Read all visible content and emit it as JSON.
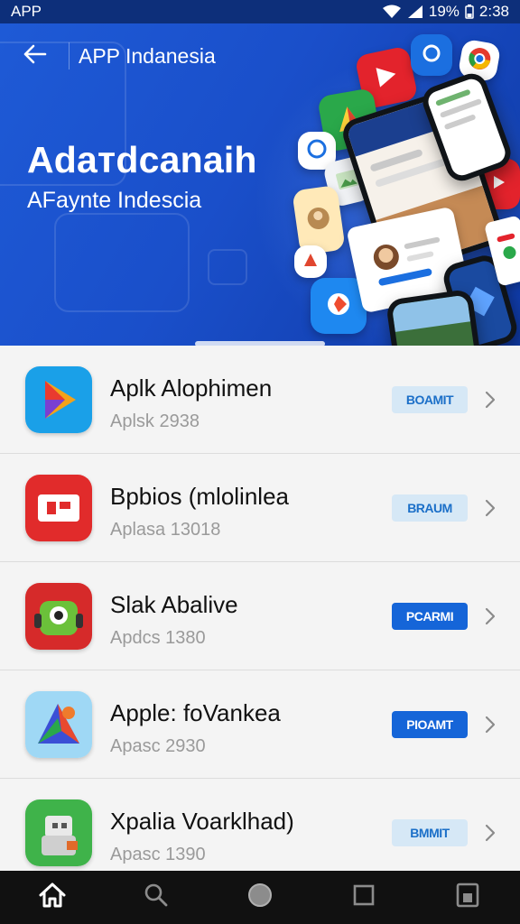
{
  "status_bar": {
    "app_label": "APP",
    "battery": "19%",
    "time": "2:38"
  },
  "header": {
    "title": "APP Indanesia",
    "back_icon": "arrow-left-icon"
  },
  "hero": {
    "title": "Adaтdcanaih",
    "subtitle": "AFaynte Indescia"
  },
  "apps": [
    {
      "name": "Aplk Alophimen",
      "meta": "Aplsk 2938",
      "action": "BOAMIT",
      "action_style": "light"
    },
    {
      "name": "Bpbios (mlolinlea",
      "meta": "Aplasa 13018",
      "action": "BRAUM",
      "action_style": "light"
    },
    {
      "name": "Slak Abalive",
      "meta": "Apdcs 1380",
      "action": "PCARMI",
      "action_style": "dark"
    },
    {
      "name": "Apple: foVankea",
      "meta": "Apasc 2930",
      "action": "PIOAMT",
      "action_style": "dark"
    },
    {
      "name": "Xpalia Voarklhad)",
      "meta": "Apasc 1390",
      "action": "BMMIT",
      "action_style": "light"
    }
  ],
  "bottom_nav": [
    "home-icon",
    "search-icon",
    "circle-icon",
    "square-icon",
    "saved-icon"
  ],
  "colors": {
    "status_bar": "#0d2f7a",
    "hero": "#1a4fca",
    "action_dark": "#1565d8",
    "action_light": "#d6e8f6",
    "nav": "#111111"
  }
}
